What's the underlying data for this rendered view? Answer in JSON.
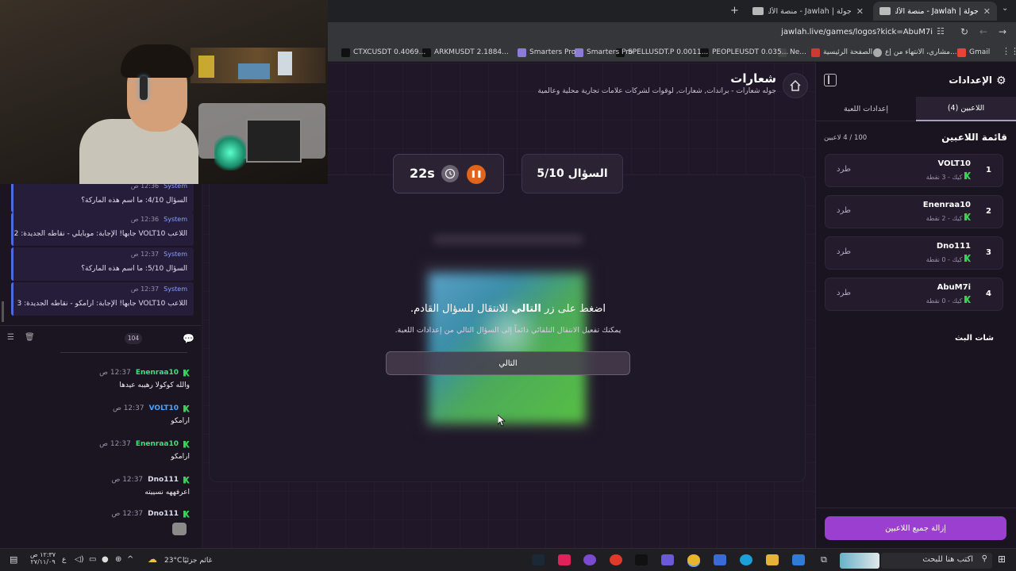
{
  "browser": {
    "tabs": [
      {
        "label": "جولة | Jawlah - منصة الألعاب الت...",
        "active": true
      },
      {
        "label": "جولة | Jawlah - منصة الألعاب الت...",
        "active": false
      }
    ],
    "url": "jawlah.live/games/logos?kick=AbuM7i",
    "bookmarks": [
      "Gmail",
      "مشاري، الانتهاء من إع...",
      "الصفحة الرئيسية",
      "Ne...",
      "PEOPLEUSDT 0.035...",
      "SPELLUSDT.P 0.0011...",
      "Smarters Pro",
      "Smarters Pro",
      "ARKMUSDT 2.1884...",
      "CTXCUSDT 0.4069..."
    ]
  },
  "game": {
    "title": "شعارات",
    "subtitle": "جوله شعارات - براندات, شعارات, لوقوات لشركات علامات تجارية محلية وعالمية",
    "question": "السؤال 5/10",
    "timer": "22s",
    "overlay_main_prefix": "اضغط على زر ",
    "overlay_main_bold": "التالي",
    "overlay_main_suffix": " للانتقال للسؤال القادم.",
    "overlay_sub": "يمكنك تفعيل الانتقال التلقائي دائماً إلى السؤال التالي من إعدادات اللعبة.",
    "next_button": "التالي",
    "colors": {
      "accent": "#e0641a",
      "purple": "#9b3fd1"
    }
  },
  "settings": {
    "title": "الإعدادات",
    "tabs": [
      {
        "label": "اللاعبين (4)",
        "active": true
      },
      {
        "label": "إعدادات اللعبة",
        "active": false
      }
    ],
    "list_title": "قائمة اللاعبين",
    "count": "100 / 4 لاعبين",
    "players": [
      {
        "rank": "1",
        "name": "VOLT10",
        "meta": "كيك - 3 نقطة",
        "kick": "طرد"
      },
      {
        "rank": "2",
        "name": "Enenraa10",
        "meta": "كيك - 2 نقطة",
        "kick": "طرد"
      },
      {
        "rank": "3",
        "name": "Dno111",
        "meta": "كيك - 0 نقطة",
        "kick": "طرد"
      },
      {
        "rank": "4",
        "name": "AbuM7i",
        "meta": "كيك - 0 نقطة",
        "kick": "طرد"
      }
    ],
    "remove_all": "إزالة جميع اللاعبين"
  },
  "chat": {
    "system_messages": [
      {
        "sender": "System",
        "time": "12:36 ص",
        "text": "السؤال 4/10: ما اسم هذه الماركة؟"
      },
      {
        "sender": "System",
        "time": "12:36 ص",
        "text": "اللاعب VOLT10 جابها! الإجابة: موبايلي - نقاطه الجديدة: 2"
      },
      {
        "sender": "System",
        "time": "12:37 ص",
        "text": "السؤال 5/10: ما اسم هذه الماركة؟"
      },
      {
        "sender": "System",
        "time": "12:37 ص",
        "text": "اللاعب VOLT10 جابها! الإجابة: ارامكو - نقاطه الجديدة: 3"
      }
    ],
    "header": "شات البث",
    "viewer_count": "104",
    "messages": [
      {
        "user": "Enenraa10",
        "time": "12:37 ص",
        "text": "والله كوكولا رهيبه عيدها"
      },
      {
        "user": "VOLT10",
        "time": "12:37 ص",
        "text": "ارامكو"
      },
      {
        "user": "Enenraa10",
        "time": "12:37 ص",
        "text": "ارامكو"
      },
      {
        "user": "Dno111",
        "time": "12:37 ص",
        "text": "اعرفههه نسييته"
      },
      {
        "user": "Dno111",
        "time": "12:37 ص",
        "text": ""
      }
    ]
  },
  "taskbar": {
    "search_placeholder": "اكتب هنا للبحث",
    "weather_text": "غائم جزئيًا",
    "temperature": "23°C",
    "time": "١٢:٣٧ ص",
    "date": "٢٧/١١/٠٩",
    "lang": "ع"
  }
}
